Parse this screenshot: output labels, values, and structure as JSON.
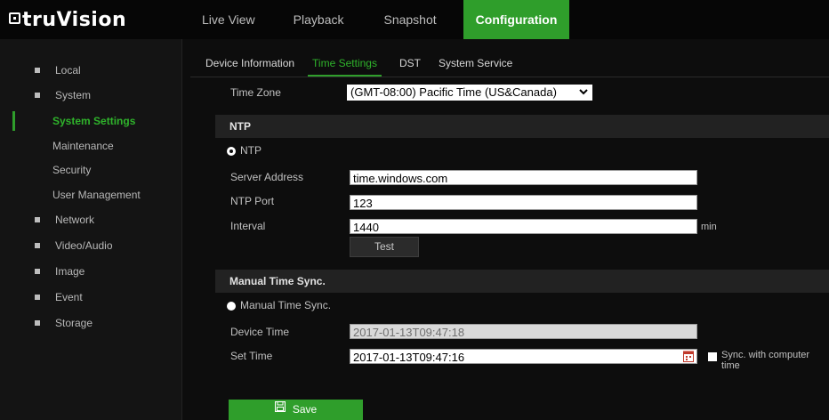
{
  "app": {
    "logo_text": "truVision"
  },
  "nav": {
    "tabs": [
      "Live View",
      "Playback",
      "Snapshot",
      "Configuration"
    ],
    "active": "Configuration"
  },
  "sidebar": {
    "items": [
      {
        "label": "Local"
      },
      {
        "label": "System"
      },
      {
        "label": "System Settings"
      },
      {
        "label": "Maintenance"
      },
      {
        "label": "Security"
      },
      {
        "label": "User Management"
      },
      {
        "label": "Network"
      },
      {
        "label": "Video/Audio"
      },
      {
        "label": "Image"
      },
      {
        "label": "Event"
      },
      {
        "label": "Storage"
      }
    ]
  },
  "subnav": {
    "tabs": [
      "Device Information",
      "Time Settings",
      "DST",
      "System Service"
    ],
    "active": "Time Settings"
  },
  "form": {
    "time_zone_label": "Time Zone",
    "time_zone_value": "(GMT-08:00) Pacific Time (US&Canada)",
    "ntp_section_title": "NTP",
    "ntp_radio_label": "NTP",
    "server_address_label": "Server Address",
    "server_address_value": "time.windows.com",
    "ntp_port_label": "NTP Port",
    "ntp_port_value": "123",
    "interval_label": "Interval",
    "interval_value": "1440",
    "interval_unit": "min",
    "test_button": "Test",
    "manual_section_title": "Manual Time Sync.",
    "manual_radio_label": "Manual Time Sync.",
    "device_time_label": "Device Time",
    "device_time_value": "2017-01-13T09:47:18",
    "set_time_label": "Set Time",
    "set_time_value": "2017-01-13T09:47:16",
    "sync_checkbox_label": "Sync. with computer time",
    "save_button": "Save"
  },
  "colors": {
    "accent": "#2f9e2b",
    "background": "#0d0d0d",
    "sidebar": "#141414",
    "section": "#222222"
  },
  "icons": [
    "logo-icon",
    "chevron-down-icon",
    "calendar-icon",
    "save-icon"
  ]
}
